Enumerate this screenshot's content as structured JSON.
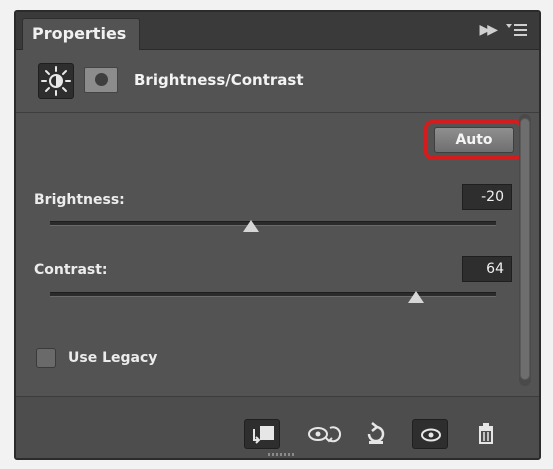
{
  "panel": {
    "tab_label": "Properties",
    "title": "Brightness/Contrast"
  },
  "auto_button": {
    "label": "Auto"
  },
  "brightness": {
    "label": "Brightness:",
    "value": "-20",
    "slider_fraction": 0.45
  },
  "contrast": {
    "label": "Contrast:",
    "value": "64",
    "slider_fraction": 0.82
  },
  "use_legacy": {
    "label": "Use Legacy",
    "checked": false
  },
  "icons": {
    "tab_collapse": "double-chevron-right-icon",
    "tab_menu": "panel-menu-icon",
    "adjustment": "brightness-contrast-sun-icon",
    "mask": "layer-mask-icon",
    "clip": "clip-to-layer-icon",
    "view_previous": "view-previous-state-icon",
    "reset": "reset-icon",
    "visibility": "eye-icon",
    "delete": "trash-icon"
  },
  "colors": {
    "panel_bg": "#535353",
    "highlight_ring": "#d51b1b"
  }
}
